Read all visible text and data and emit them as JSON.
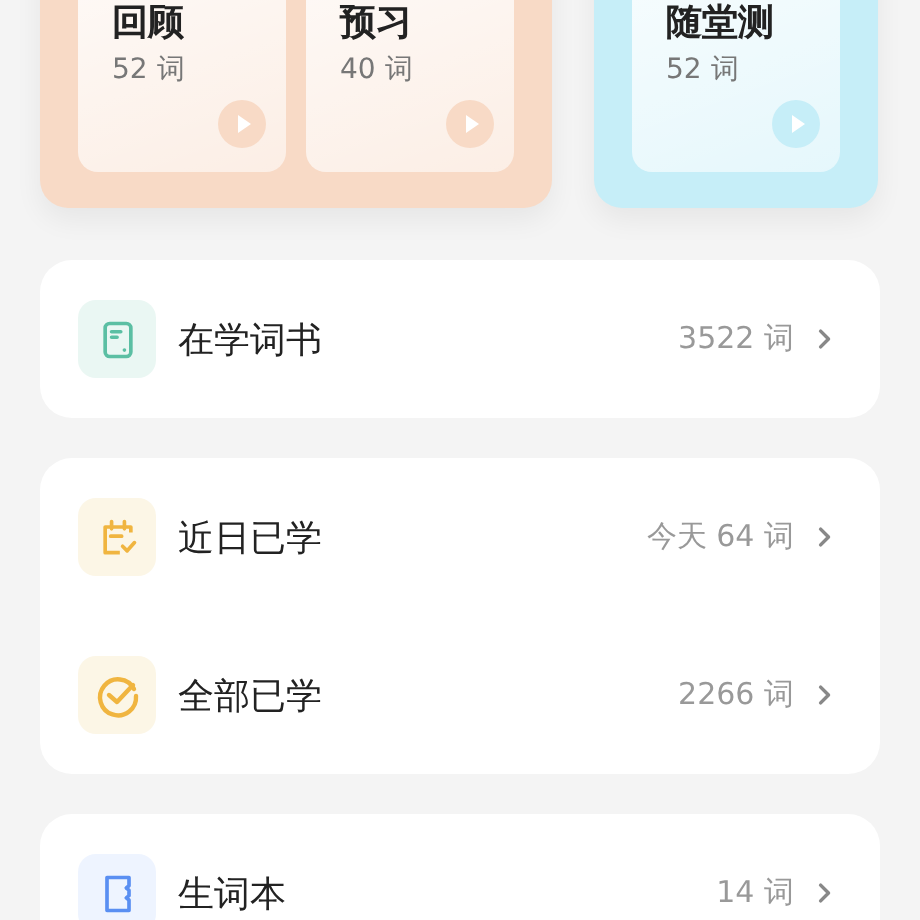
{
  "practice_groups": [
    {
      "color": "#f8dac6",
      "cards": [
        {
          "title": "回顾",
          "count": "52 词"
        },
        {
          "title": "预习",
          "count": "40 词"
        }
      ]
    },
    {
      "color": "#c6eef8",
      "cards": [
        {
          "title": "随堂测",
          "count": "52 词"
        }
      ]
    }
  ],
  "sections": [
    {
      "rows": [
        {
          "kind": "book",
          "label": "在学词书",
          "value": "3522 词"
        }
      ]
    },
    {
      "rows": [
        {
          "kind": "calendar",
          "label": "近日已学",
          "value": "今天 64 词"
        },
        {
          "kind": "check",
          "label": "全部已学",
          "value": "2266 词"
        }
      ]
    },
    {
      "rows": [
        {
          "kind": "notebook",
          "label": "生词本",
          "value": "14 词"
        }
      ]
    }
  ]
}
